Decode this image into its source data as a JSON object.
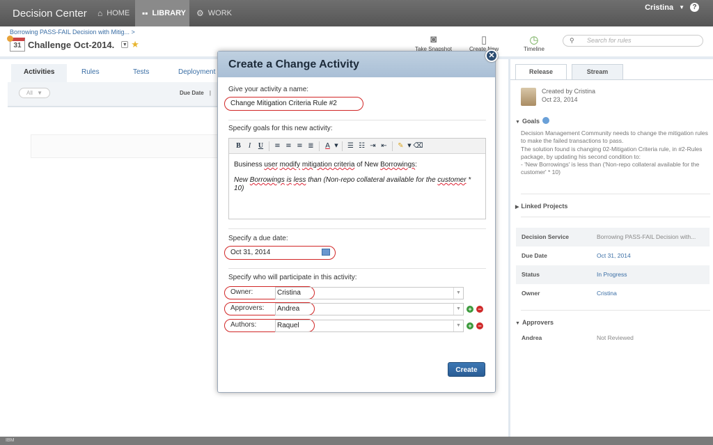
{
  "topbar": {
    "brand": "Decision Center",
    "nav": [
      {
        "label": "HOME",
        "icon": "home-icon"
      },
      {
        "label": "LIBRARY",
        "icon": "library-grid-icon"
      },
      {
        "label": "WORK",
        "icon": "gear-icon"
      }
    ],
    "user": "Cristina"
  },
  "header": {
    "breadcrumb": "Borrowing PASS-FAIL Decision with Mitig... >",
    "title": "Challenge Oct-2014.",
    "calendar_day": "31",
    "tools": [
      {
        "label": "Take Snapshot",
        "icon": "camera-icon"
      },
      {
        "label": "Create New",
        "icon": "new-document-icon"
      },
      {
        "label": "Timeline",
        "icon": "timeline-icon"
      }
    ],
    "search_placeholder": "Search for rules"
  },
  "left": {
    "tabs": [
      "Activities",
      "Rules",
      "Tests",
      "Deployment"
    ],
    "filter": "All",
    "due_date_header": "Due Date"
  },
  "dialog": {
    "title": "Create a Change Activity",
    "name_label": "Give your activity a name:",
    "name_value": "Change Mitigation Criteria Rule #2",
    "goals_label": "Specify goals for this new activity:",
    "toolbar": [
      "B",
      "I",
      "U"
    ],
    "goal_line1_parts": [
      "Business ",
      "user",
      " ",
      "modify",
      " ",
      "mitigation criteria",
      " of New ",
      "Borrowings",
      ":"
    ],
    "goal_line2_parts": [
      "New ",
      "Borrowings",
      " ",
      "is",
      " ",
      "less",
      " than (Non-repo collateral available for the ",
      "customer",
      " * 10)"
    ],
    "due_label": "Specify a due date:",
    "due_value": "Oct 31, 2014",
    "participants_label": "Specify who will participate in this activity:",
    "participants": [
      {
        "role": "Owner:",
        "name": "Cristina"
      },
      {
        "role": "Approvers:",
        "name": "Andrea"
      },
      {
        "role": "Authors:",
        "name": "Raquel"
      }
    ],
    "create_label": "Create"
  },
  "right": {
    "tabs": [
      "Release",
      "Stream"
    ],
    "created_by": "Created by Cristina",
    "created_date": "Oct 23, 2014",
    "goals_title": "Goals",
    "goals_text": [
      "Decision Management Community needs to change the mitigation rules to make the failed transactions to pass.",
      "The solution found is changing 02-Mitigation Criteria rule, in #2-Rules package, by updating his second condition to:",
      "- 'New Borrowings' is less than ('Non-repo collateral available for the customer' * 10)"
    ],
    "linked_projects": "Linked Projects",
    "props": [
      {
        "key": "Decision Service",
        "value": "Borrowing PASS-FAIL Decision with..."
      },
      {
        "key": "Due Date",
        "value": "Oct 31, 2014"
      },
      {
        "key": "Status",
        "value": "In Progress"
      },
      {
        "key": "Owner",
        "value": "Cristina"
      }
    ],
    "approvers_title": "Approvers",
    "approvers": [
      {
        "name": "Andrea",
        "status": "Not Reviewed"
      }
    ]
  },
  "footer": "IBM",
  "colors": {
    "accent": "#3a6ea5",
    "highlight": "#d12626",
    "topbar": "#5f5f5f"
  }
}
